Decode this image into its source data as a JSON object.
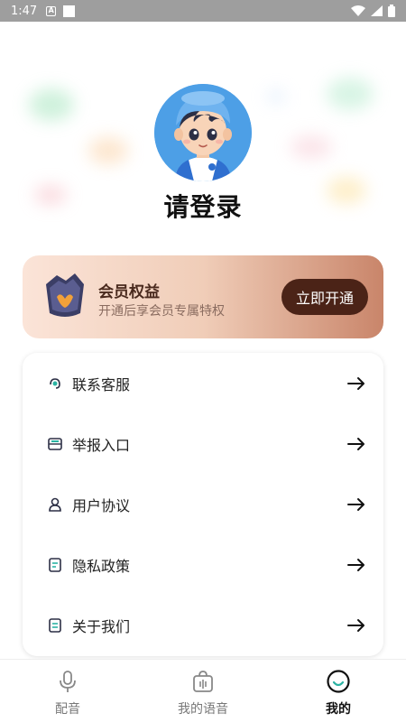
{
  "status_bar": {
    "time": "1:47",
    "notif_a": "A"
  },
  "profile": {
    "login_text": "请登录"
  },
  "member": {
    "title": "会员权益",
    "subtitle": "开通后享会员专属特权",
    "button": "立即开通"
  },
  "menu": {
    "items": [
      {
        "label": "联系客服",
        "icon": "headset-icon"
      },
      {
        "label": "举报入口",
        "icon": "report-inbox-icon"
      },
      {
        "label": "用户协议",
        "icon": "user-icon"
      },
      {
        "label": "隐私政策",
        "icon": "document-icon"
      },
      {
        "label": "关于我们",
        "icon": "info-document-icon"
      }
    ]
  },
  "nav": {
    "items": [
      {
        "label": "配音",
        "icon": "microphone-icon",
        "active": false
      },
      {
        "label": "我的语音",
        "icon": "voice-bag-icon",
        "active": false
      },
      {
        "label": "我的",
        "icon": "smile-face-icon",
        "active": true
      }
    ]
  },
  "colors": {
    "accent": "#4b2317",
    "card_gradient_start": "#fbe4d8",
    "card_gradient_end": "#c9856a",
    "icon_teal": "#2bb3a3"
  }
}
